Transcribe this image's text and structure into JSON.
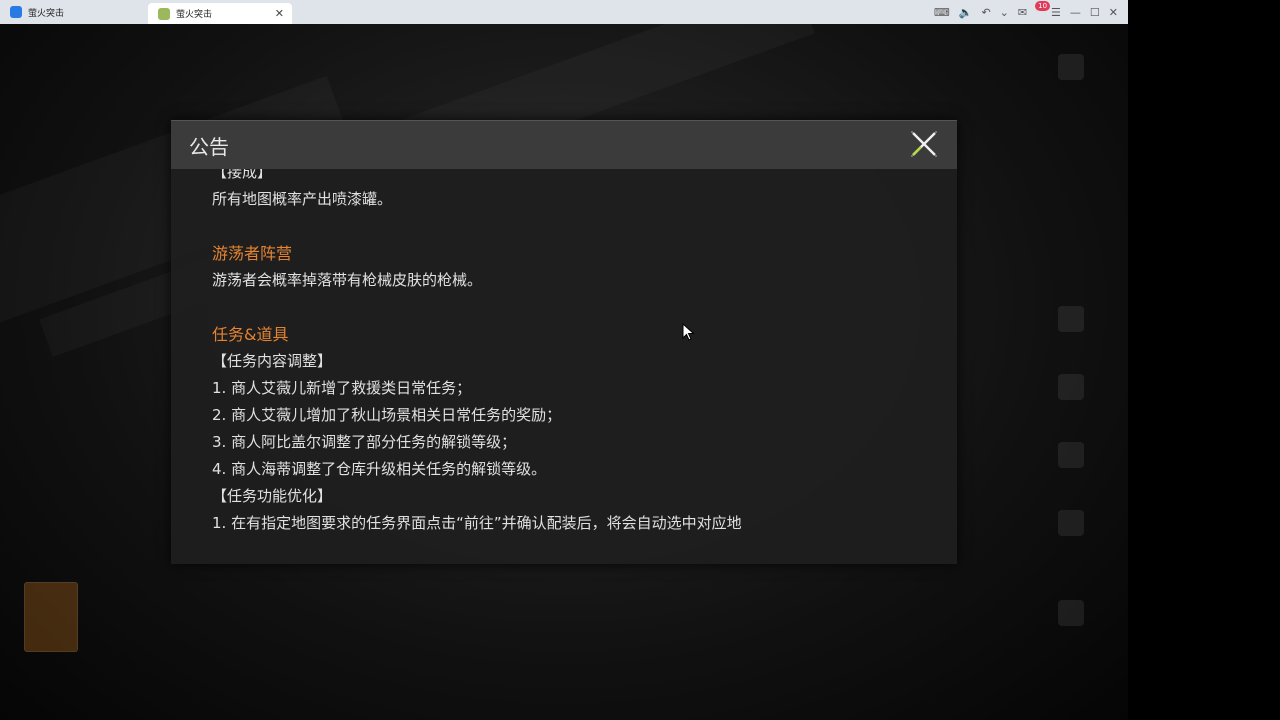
{
  "browser": {
    "tabs": [
      {
        "label": "萤火突击",
        "active": false
      },
      {
        "label": "萤火突击",
        "active": true
      }
    ],
    "notification_count": "10"
  },
  "dialog": {
    "title": "公告",
    "lines": [
      {
        "text": "【接成】",
        "style": "normal"
      },
      {
        "text": "所有地图概率产出喷漆罐。",
        "style": "normal"
      },
      {
        "text": "",
        "style": "spacer"
      },
      {
        "text": "游荡者阵营",
        "style": "orange"
      },
      {
        "text": "游荡者会概率掉落带有枪械皮肤的枪械。",
        "style": "normal"
      },
      {
        "text": "",
        "style": "spacer"
      },
      {
        "text": "任务&道具",
        "style": "orange"
      },
      {
        "text": "【任务内容调整】",
        "style": "normal"
      },
      {
        "text": "1. 商人艾薇儿新增了救援类日常任务；",
        "style": "normal"
      },
      {
        "text": "2. 商人艾薇儿增加了秋山场景相关日常任务的奖励；",
        "style": "normal"
      },
      {
        "text": "3. 商人阿比盖尔调整了部分任务的解锁等级；",
        "style": "normal"
      },
      {
        "text": "4. 商人海蒂调整了仓库升级相关任务的解锁等级。",
        "style": "normal"
      },
      {
        "text": "【任务功能优化】",
        "style": "normal"
      },
      {
        "text": "1. 在有指定地图要求的任务界面点击“前往”并确认配装后，将会自动选中对应地",
        "style": "normal"
      }
    ]
  },
  "colors": {
    "accent_orange": "#e48432",
    "close_x_green": "#b7d94a"
  }
}
